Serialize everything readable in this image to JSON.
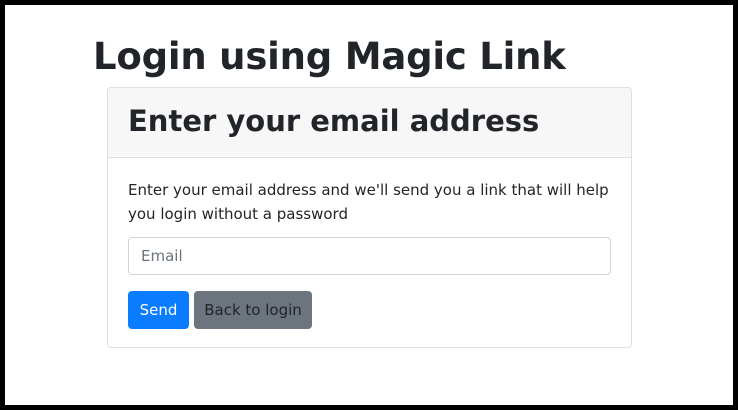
{
  "page": {
    "title": "Login using Magic Link"
  },
  "card": {
    "header_title": "Enter your email address",
    "description": "Enter your email address and we'll send you a link that will help you login without a password",
    "email": {
      "placeholder": "Email",
      "value": ""
    },
    "buttons": {
      "send_label": "Send",
      "back_label": "Back to login"
    }
  },
  "colors": {
    "primary": "#0a7cff",
    "secondary": "#6c757d",
    "header_bg": "#f7f7f7",
    "border": "#dfdfdf"
  }
}
